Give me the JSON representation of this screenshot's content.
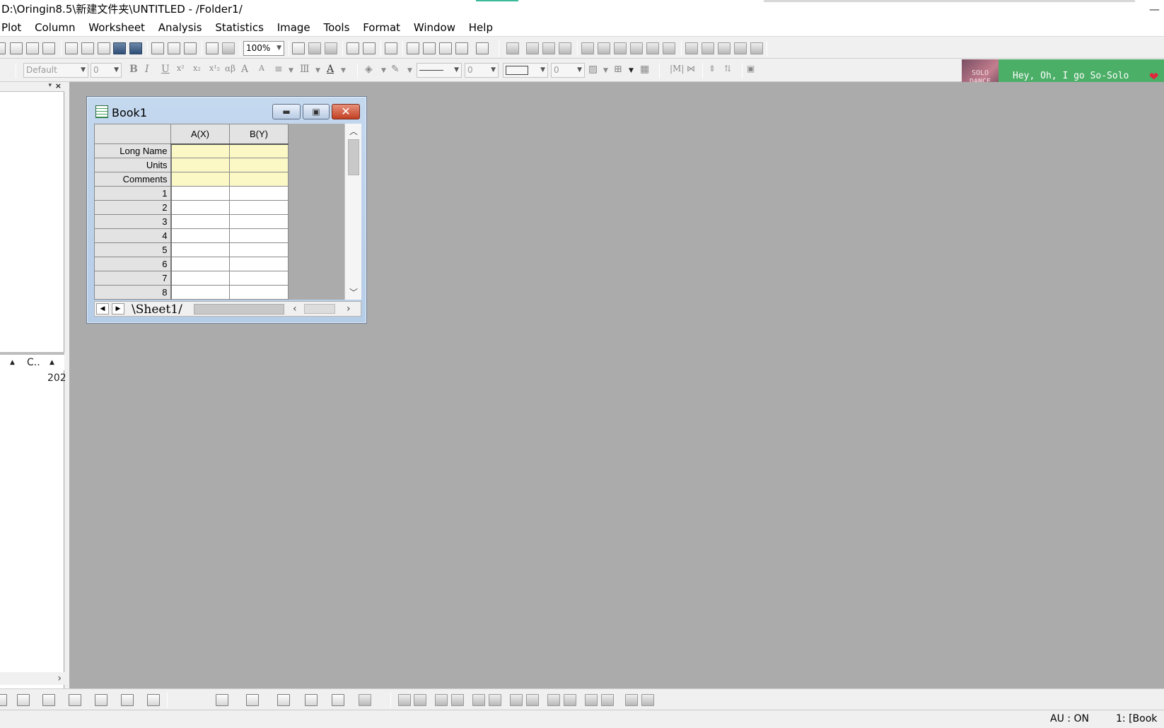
{
  "window": {
    "title": "D:\\Oringin8.5\\新建文件夹\\UNTITLED - /Folder1/"
  },
  "menu": [
    "Plot",
    "Column",
    "Worksheet",
    "Analysis",
    "Statistics",
    "Image",
    "Tools",
    "Format",
    "Window",
    "Help"
  ],
  "toolbar": {
    "zoom_value": "100%",
    "font_name": "Default",
    "font_size": "0",
    "line_width": "0",
    "border_width": "0"
  },
  "promo": {
    "thumb_text": "SOLO DANCE",
    "text": "Hey, Oh, I go So-Solo",
    "heart": "❤"
  },
  "leftpanel": {
    "column_label": "C..",
    "cell_value": "202"
  },
  "book": {
    "title": "Book1",
    "columns": [
      "A(X)",
      "B(Y)"
    ],
    "meta_rows": [
      "Long Name",
      "Units",
      "Comments"
    ],
    "data_rows": [
      "1",
      "2",
      "3",
      "4",
      "5",
      "6",
      "7",
      "8"
    ],
    "sheet_tab": "Sheet1"
  },
  "status": {
    "autoupdate": "AU : ON",
    "active": "1: [Book"
  }
}
